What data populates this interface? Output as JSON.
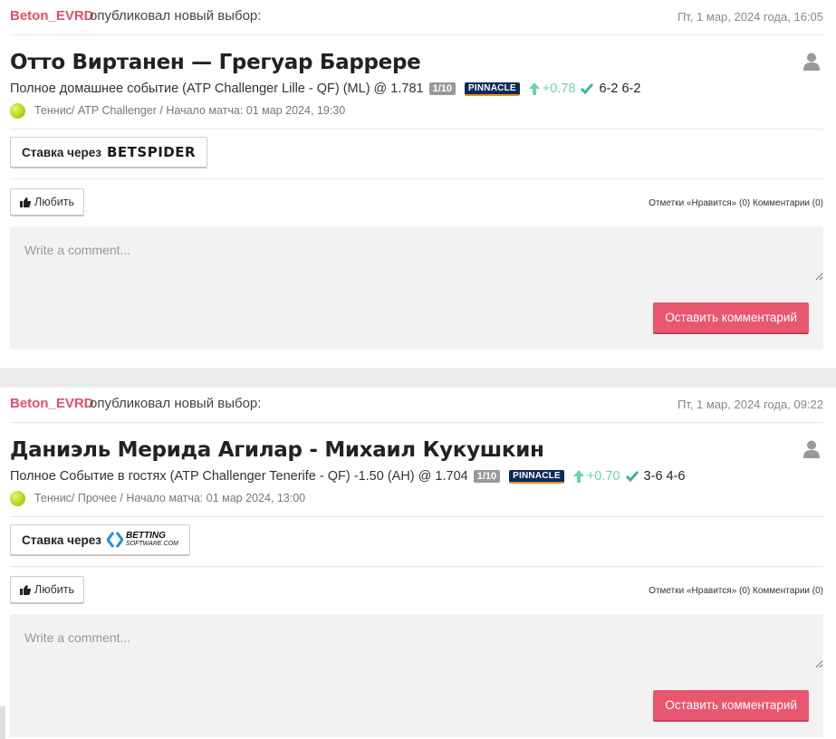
{
  "posts": [
    {
      "author": "Beton_EVRD",
      "action": "опубликовал новый выбор:",
      "date": "Пт, 1 мар, 2024 года, 16:05",
      "title": "Отто Виртанен — Грегуар Баррере",
      "pick": "Полное домашнее событие (ATP Challenger Lille - QF) (ML) @ 1.781",
      "stake": "1/10",
      "bookmaker": "PINNACLE",
      "delta": "+0.78",
      "score": "6-2 6-2",
      "meta": "Теннис/ ATP Challenger / Начало матча: 01 мар 2024, 19:30",
      "bet_via": "Ставка через",
      "bet_logo": "BETSPIDER",
      "like_label": "Любить",
      "counts": "Отметки «Нравится» (0) Комментарии (0)",
      "comment_placeholder": "Write a comment...",
      "submit_label": "Оставить комментарий"
    },
    {
      "author": "Beton_EVRD",
      "action": "опубликовал новый выбор:",
      "date": "Пт, 1 мар, 2024 года, 09:22",
      "title": "Даниэль Мерида Агилар - Михаил Кукушкин",
      "pick": "Полное Событие в гостях (ATP Challenger Tenerife - QF) -1.50 (AH) @ 1.704",
      "stake": "1/10",
      "bookmaker": "PINNACLE",
      "delta": "+0.70",
      "score": "3-6 4-6",
      "meta": "Теннис/ Прочее / Начало матча: 01 мар 2024, 13:00",
      "bet_via": "Ставка через",
      "bet_logo_line1": "BETTING",
      "bet_logo_line2": "SOFTWARE.COM",
      "like_label": "Любить",
      "counts": "Отметки «Нравится» (0) Комментарии (0)",
      "comment_placeholder": "Write a comment...",
      "submit_label": "Оставить комментарий"
    }
  ],
  "colors": {
    "author": "#e0506a",
    "delta": "#6dd2b4",
    "submit": "#e8566f",
    "pinnacle": "#0b2a5b"
  },
  "icons": [
    "user-icon",
    "arrow-up-icon",
    "check-icon",
    "tennis-ball-icon",
    "thumbs-up-icon",
    "betting-software-logo-icon"
  ]
}
